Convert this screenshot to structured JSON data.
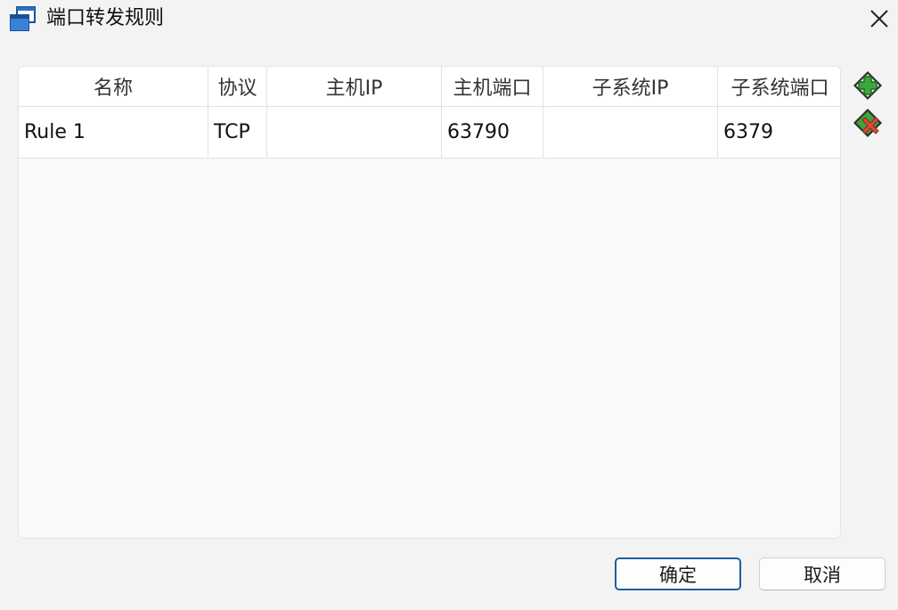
{
  "window": {
    "title": "端口转发规则",
    "icon": "window-copy-icon",
    "close": "close-icon"
  },
  "table": {
    "columns": [
      "名称",
      "协议",
      "主机IP",
      "主机端口",
      "子系统IP",
      "子系统端口"
    ],
    "rows": [
      [
        "Rule 1",
        "TCP",
        "",
        "63790",
        "",
        "6379"
      ]
    ]
  },
  "side_buttons": {
    "add": "add-rule-icon",
    "remove": "remove-rule-icon"
  },
  "footer": {
    "ok_label": "确定",
    "cancel_label": "取消"
  },
  "colors": {
    "accent": "#1f5f9e",
    "add_green": "#3aa83a",
    "remove_red": "#e0483a"
  }
}
